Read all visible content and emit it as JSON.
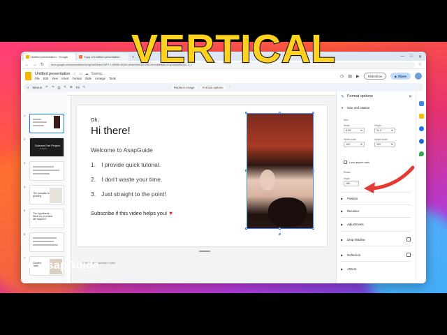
{
  "browser": {
    "tabs": [
      {
        "label": "Untitled presentation - Google"
      },
      {
        "label": "Copy of Untitled presentation"
      }
    ],
    "new_tab": "+",
    "controls": [
      "—",
      "□",
      "✕"
    ],
    "url": "docs.google.com/presentation/d/1gDdd2h0asXX3PT-1-NNiSk-0fQkK-wKsbH8dX5bD2r5G3fu/edit#slide=id.g2a4b8d9e2b3_0_1"
  },
  "app": {
    "title": "Untitled presentation",
    "saving": "Saving...",
    "menus": [
      "File",
      "Edit",
      "View",
      "Insert",
      "Format",
      "Slide",
      "Arrange",
      "Tools"
    ],
    "slideshow_label": "Slideshow",
    "share_label": "Share"
  },
  "toolbar": {
    "search": "Menus",
    "zoom": "Fit",
    "replace": "Replace image",
    "format_options": "Format options"
  },
  "filmstrip": {
    "slides": [
      {
        "num": "1",
        "text": ""
      },
      {
        "num": "2",
        "text": "Science Fair Project",
        "sub": "by Name"
      },
      {
        "num": "3",
        "text": ""
      },
      {
        "num": "4",
        "text": "The pumpkin is growing"
      },
      {
        "num": "5",
        "text": "The hypothesis… What do you think will happen?"
      },
      {
        "num": "6",
        "text": ""
      },
      {
        "num": "7",
        "text": "Growing habit"
      }
    ]
  },
  "slide": {
    "oh": "Oh,",
    "hi": "Hi there!",
    "welcome": "Welcome to AsapGuide",
    "items": [
      {
        "num": "1.",
        "text": "I provide quick tutorial."
      },
      {
        "num": "2.",
        "text": "I don't waste your time."
      },
      {
        "num": "3.",
        "text": "Just straight to the point!"
      }
    ],
    "subscribe": "Subscribe if this video helps you!",
    "speaker_notes": "Click to add speaker notes"
  },
  "format_panel": {
    "title": "Format options",
    "size_rotation": "Size and rotation",
    "size_label": "Size",
    "width_label": "Width",
    "width_value": "6.54",
    "height_label": "Height",
    "height_value": "11.4",
    "in_unit": "in",
    "width_scale_label": "Width scale",
    "width_scale_value": "100",
    "height_scale_label": "Height scale",
    "height_scale_value": "100",
    "percent": "%",
    "lock_aspect": "Lock aspect ratio",
    "rotate_label": "Rotate",
    "angle_label": "Angle",
    "angle_value": "180",
    "degree": "°",
    "sections": [
      "Position",
      "Recolour",
      "Adjustments",
      "Drop shadow",
      "Reflection",
      "Alt text"
    ]
  },
  "overlay": {
    "headline": "VERTICAL",
    "brand": "AsapGuide"
  },
  "colors": {
    "accent_blue": "#1a73e8",
    "headline_yellow": "#ffd21f",
    "arrow_red": "#e53935",
    "share_bg": "#c2dcf7"
  }
}
